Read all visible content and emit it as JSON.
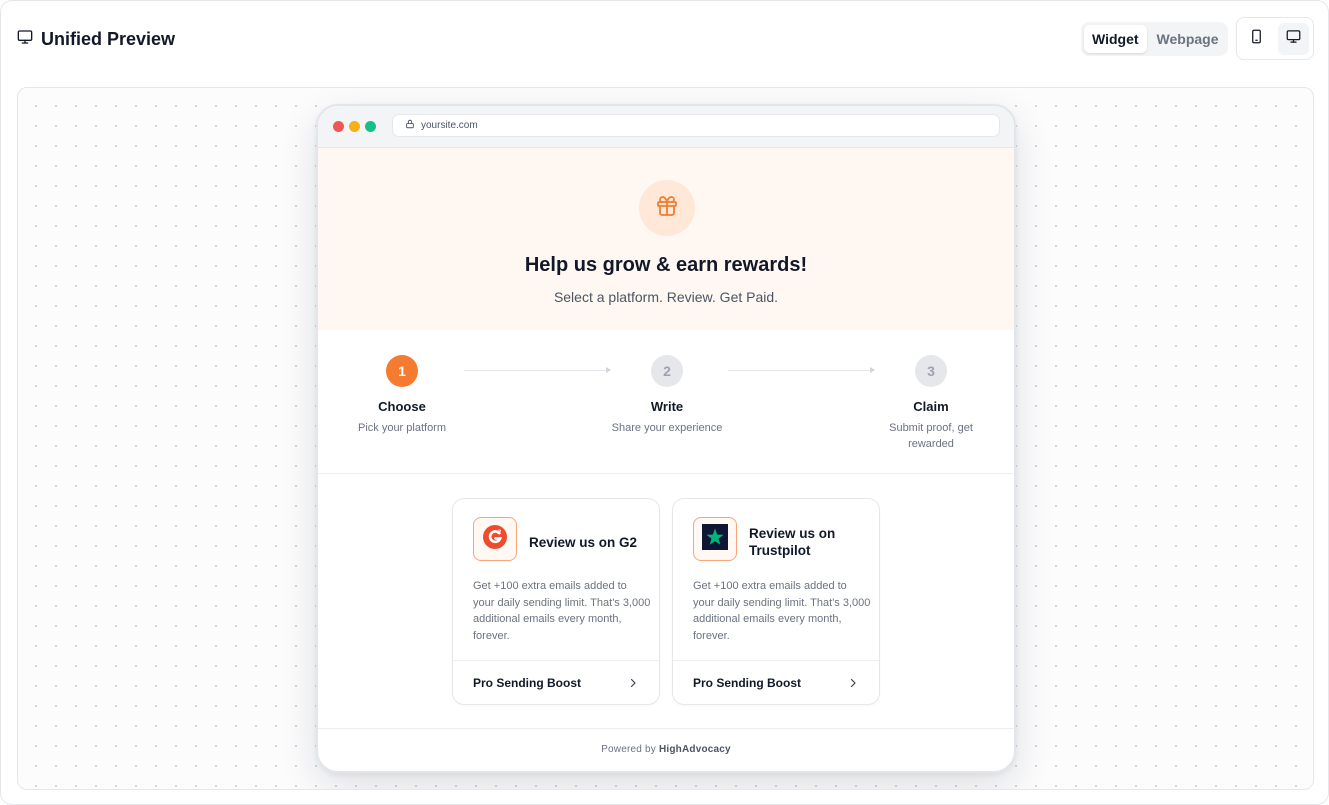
{
  "header": {
    "title": "Unified Preview",
    "title_icon": "monitor-icon",
    "view_modes": [
      {
        "label": "Widget",
        "active": true
      },
      {
        "label": "Webpage",
        "active": false
      }
    ],
    "devices": [
      {
        "icon": "smartphone-icon",
        "active": false
      },
      {
        "icon": "monitor-icon",
        "active": true
      }
    ]
  },
  "browser": {
    "url": "yoursite.com",
    "url_icon": "lock-icon"
  },
  "widget": {
    "hero": {
      "icon": "gift-icon",
      "title": "Help us grow & earn rewards!",
      "subtitle": "Select a platform. Review. Get Paid."
    },
    "steps": [
      {
        "number": "1",
        "title": "Choose",
        "description": "Pick your platform",
        "active": true
      },
      {
        "number": "2",
        "title": "Write",
        "description": "Share your experience",
        "active": false
      },
      {
        "number": "3",
        "title": "Claim",
        "description": "Submit proof, get rewarded",
        "active": false
      }
    ],
    "cards": [
      {
        "icon": "g2-logo-icon",
        "title": "Review us on G2",
        "description": "Get +100 extra emails added to your daily sending limit. That's 3,000 additional emails every month, forever.",
        "reward": "Pro Sending Boost"
      },
      {
        "icon": "trustpilot-star-icon",
        "title": "Review us on Trustpilot",
        "description": "Get +100 extra emails added to your daily sending limit. That's 3,000 additional emails every month, forever.",
        "reward": "Pro Sending Boost"
      }
    ],
    "footer": {
      "prefix": "Powered by",
      "brand": "HighAdvocacy"
    }
  },
  "colors": {
    "accent": "#f47b2f",
    "hero_bg": "#fff7f1",
    "trustpilot_green": "#00b67a"
  }
}
